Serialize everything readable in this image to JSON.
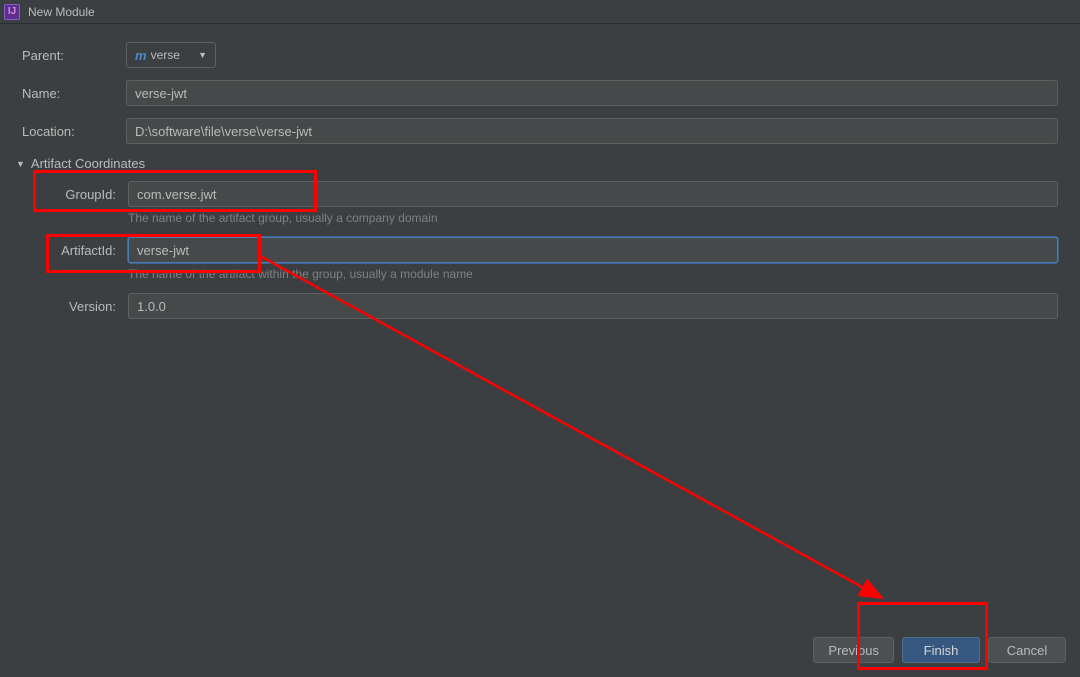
{
  "window": {
    "title": "New Module"
  },
  "labels": {
    "parent": "Parent:",
    "name": "Name:",
    "location": "Location:",
    "artifactCoordinates": "Artifact Coordinates",
    "groupId": "GroupId:",
    "artifactId": "ArtifactId:",
    "version": "Version:"
  },
  "values": {
    "parent": "verse",
    "name": "verse-jwt",
    "location": "D:\\software\\file\\verse\\verse-jwt",
    "groupId": "com.verse.jwt",
    "artifactId": "verse-jwt",
    "version": "1.0.0"
  },
  "hints": {
    "groupId": "The name of the artifact group, usually a company domain",
    "artifactId": "The name of the artifact within the group, usually a module name"
  },
  "buttons": {
    "previous": "Previous",
    "finish": "Finish",
    "cancel": "Cancel"
  }
}
